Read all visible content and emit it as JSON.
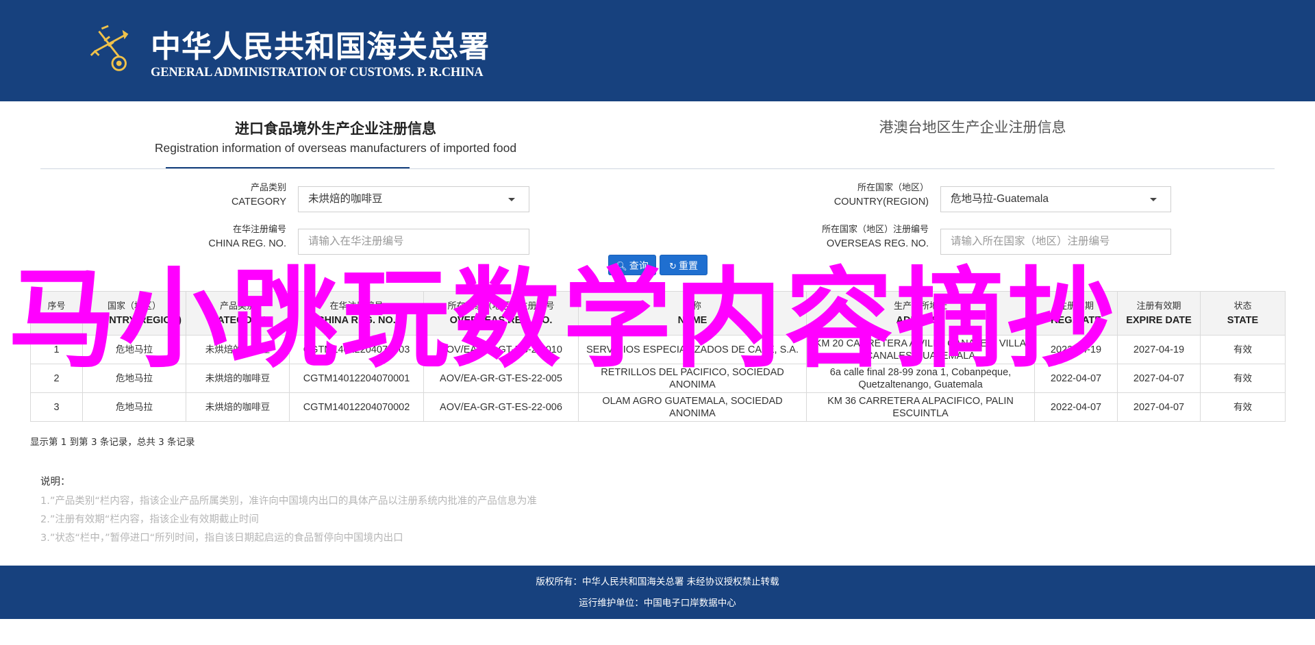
{
  "header": {
    "title_cn": "中华人民共和国海关总署",
    "title_en": "GENERAL ADMINISTRATION OF CUSTOMS. P. R.CHINA"
  },
  "tabs": [
    {
      "label_cn": "进口食品境外生产企业注册信息",
      "label_en": "Registration information of overseas manufacturers of imported food",
      "active": true
    },
    {
      "label_cn": "港澳台地区生产企业注册信息",
      "active": false
    }
  ],
  "form": {
    "category": {
      "label_cn": "产品类别",
      "label_en": "CATEGORY",
      "value": "未烘焙的咖啡豆"
    },
    "country": {
      "label_cn": "所在国家（地区）",
      "label_en": "COUNTRY(REGION)",
      "value": "危地马拉-Guatemala"
    },
    "china_reg": {
      "label_cn": "在华注册编号",
      "label_en": "CHINA REG. NO.",
      "placeholder": "请输入在华注册编号"
    },
    "overseas_reg": {
      "label_cn": "所在国家（地区）注册编号",
      "label_en": "OVERSEAS REG. NO.",
      "placeholder": "请输入所在国家（地区）注册编号"
    },
    "search_label": "查询",
    "reset_label": "重置"
  },
  "table": {
    "columns": [
      {
        "cn": "序号",
        "en": "NO."
      },
      {
        "cn": "国家（地区）",
        "en": "COUNTRY(REGION)"
      },
      {
        "cn": "产品类别",
        "en": "CATEGORY"
      },
      {
        "cn": "在华注册编号",
        "en": "CHINA REG. NO."
      },
      {
        "cn": "所在国家（地区）注册编号",
        "en": "OVERSEAS REG. NO."
      },
      {
        "cn": "名称",
        "en": "NAME"
      },
      {
        "cn": "生产场所地址",
        "en": "ADDRESS"
      },
      {
        "cn": "注册日期",
        "en": "REG.DATE"
      },
      {
        "cn": "注册有效期",
        "en": "EXPIRE DATE"
      },
      {
        "cn": "状态",
        "en": "STATE"
      }
    ],
    "rows": [
      [
        "1",
        "危地马拉",
        "未烘焙的咖啡豆",
        "CGTM14012204070003",
        "AOV/EA-GR-GT-ES-22-010",
        "SERVICIOS ESPECIALIZADOS DE CAFE, S.A.",
        "KM 20 CARRETERA A VILLA CANALES, VILLA CANALES GUATEMALA",
        "2022-04-19",
        "2027-04-19",
        "有效"
      ],
      [
        "2",
        "危地马拉",
        "未烘焙的咖啡豆",
        "CGTM14012204070001",
        "AOV/EA-GR-GT-ES-22-005",
        "RETRILLOS DEL PACIFICO, SOCIEDAD ANONIMA",
        "6a calle final 28-99 zona 1, Cobanpeque, Quetzaltenango, Guatemala",
        "2022-04-07",
        "2027-04-07",
        "有效"
      ],
      [
        "3",
        "危地马拉",
        "未烘焙的咖啡豆",
        "CGTM14012204070002",
        "AOV/EA-GR-GT-ES-22-006",
        "OLAM AGRO GUATEMALA, SOCIEDAD ANONIMA",
        "KM 36 CARRETERA ALPACIFICO, PALIN ESCUINTLA",
        "2022-04-07",
        "2027-04-07",
        "有效"
      ]
    ]
  },
  "summary": "显示第 1 到第 3 条记录，总共 3 条记录",
  "notes": {
    "title": "说明：",
    "items": [
      "1.”产品类别“栏内容，指该企业产品所属类别，准许向中国境内出口的具体产品以注册系统内批准的产品信息为准",
      "2.”注册有效期“栏内容，指该企业有效期截止时间",
      "3.”状态“栏中，”暂停进口“所列时间，指自该日期起启运的食品暂停向中国境内出口"
    ]
  },
  "footer": {
    "line1": "版权所有：中华人民共和国海关总署 未经协议授权禁止转载",
    "line2": "运行维护单位：中国电子口岸数据中心"
  },
  "watermark": "马小跳玩数学内容摘抄",
  "colors": {
    "brand_blue": "#17417e",
    "button_blue": "#1f6fd0",
    "watermark": "#ff00ff"
  }
}
